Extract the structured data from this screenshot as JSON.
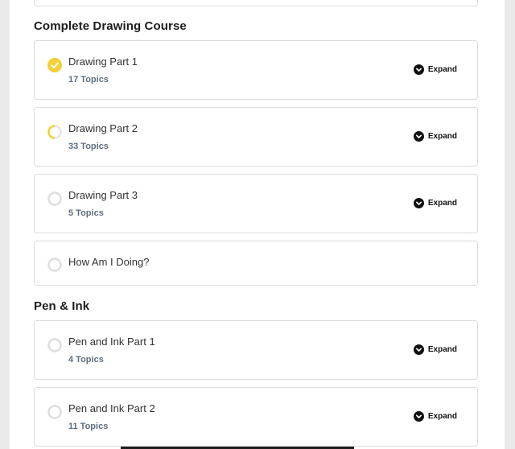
{
  "sections": [
    {
      "title": "Complete Drawing Course",
      "lessons": [
        {
          "title": "Drawing Part 1",
          "topics": "17 Topics",
          "expand_label": "Expand",
          "status": "complete"
        },
        {
          "title": "Drawing Part 2",
          "topics": "33 Topics",
          "expand_label": "Expand",
          "status": "in-progress"
        },
        {
          "title": "Drawing Part 3",
          "topics": "5 Topics",
          "expand_label": "Expand",
          "status": "not-started"
        },
        {
          "title": "How Am I Doing?",
          "status": "not-started"
        }
      ]
    },
    {
      "title": "Pen & Ink",
      "lessons": [
        {
          "title": "Pen and Ink Part 1",
          "topics": "4 Topics",
          "expand_label": "Expand",
          "status": "not-started"
        },
        {
          "title": "Pen and Ink Part 2",
          "topics": "11 Topics",
          "expand_label": "Expand",
          "status": "not-started"
        }
      ]
    }
  ],
  "colors": {
    "complete": "#f5cf36",
    "in_progress": "#f5cf36",
    "not_started": "#dddddd",
    "topics_text": "#5d6f7f"
  }
}
